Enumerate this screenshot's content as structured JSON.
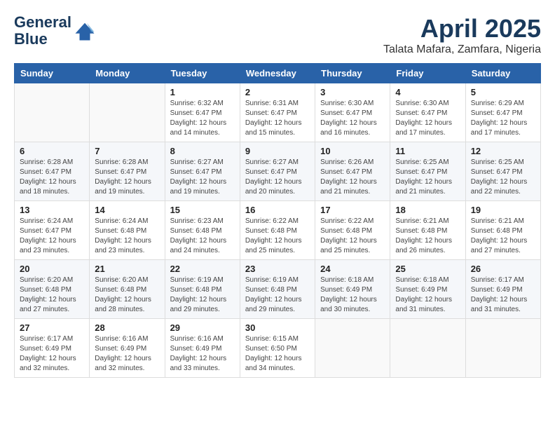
{
  "header": {
    "logo_line1": "General",
    "logo_line2": "Blue",
    "title": "April 2025",
    "subtitle": "Talata Mafara, Zamfara, Nigeria"
  },
  "days_of_week": [
    "Sunday",
    "Monday",
    "Tuesday",
    "Wednesday",
    "Thursday",
    "Friday",
    "Saturday"
  ],
  "weeks": [
    [
      {
        "day": "",
        "sunrise": "",
        "sunset": "",
        "daylight": ""
      },
      {
        "day": "",
        "sunrise": "",
        "sunset": "",
        "daylight": ""
      },
      {
        "day": "1",
        "sunrise": "Sunrise: 6:32 AM",
        "sunset": "Sunset: 6:47 PM",
        "daylight": "Daylight: 12 hours and 14 minutes."
      },
      {
        "day": "2",
        "sunrise": "Sunrise: 6:31 AM",
        "sunset": "Sunset: 6:47 PM",
        "daylight": "Daylight: 12 hours and 15 minutes."
      },
      {
        "day": "3",
        "sunrise": "Sunrise: 6:30 AM",
        "sunset": "Sunset: 6:47 PM",
        "daylight": "Daylight: 12 hours and 16 minutes."
      },
      {
        "day": "4",
        "sunrise": "Sunrise: 6:30 AM",
        "sunset": "Sunset: 6:47 PM",
        "daylight": "Daylight: 12 hours and 17 minutes."
      },
      {
        "day": "5",
        "sunrise": "Sunrise: 6:29 AM",
        "sunset": "Sunset: 6:47 PM",
        "daylight": "Daylight: 12 hours and 17 minutes."
      }
    ],
    [
      {
        "day": "6",
        "sunrise": "Sunrise: 6:28 AM",
        "sunset": "Sunset: 6:47 PM",
        "daylight": "Daylight: 12 hours and 18 minutes."
      },
      {
        "day": "7",
        "sunrise": "Sunrise: 6:28 AM",
        "sunset": "Sunset: 6:47 PM",
        "daylight": "Daylight: 12 hours and 19 minutes."
      },
      {
        "day": "8",
        "sunrise": "Sunrise: 6:27 AM",
        "sunset": "Sunset: 6:47 PM",
        "daylight": "Daylight: 12 hours and 19 minutes."
      },
      {
        "day": "9",
        "sunrise": "Sunrise: 6:27 AM",
        "sunset": "Sunset: 6:47 PM",
        "daylight": "Daylight: 12 hours and 20 minutes."
      },
      {
        "day": "10",
        "sunrise": "Sunrise: 6:26 AM",
        "sunset": "Sunset: 6:47 PM",
        "daylight": "Daylight: 12 hours and 21 minutes."
      },
      {
        "day": "11",
        "sunrise": "Sunrise: 6:25 AM",
        "sunset": "Sunset: 6:47 PM",
        "daylight": "Daylight: 12 hours and 21 minutes."
      },
      {
        "day": "12",
        "sunrise": "Sunrise: 6:25 AM",
        "sunset": "Sunset: 6:47 PM",
        "daylight": "Daylight: 12 hours and 22 minutes."
      }
    ],
    [
      {
        "day": "13",
        "sunrise": "Sunrise: 6:24 AM",
        "sunset": "Sunset: 6:47 PM",
        "daylight": "Daylight: 12 hours and 23 minutes."
      },
      {
        "day": "14",
        "sunrise": "Sunrise: 6:24 AM",
        "sunset": "Sunset: 6:48 PM",
        "daylight": "Daylight: 12 hours and 23 minutes."
      },
      {
        "day": "15",
        "sunrise": "Sunrise: 6:23 AM",
        "sunset": "Sunset: 6:48 PM",
        "daylight": "Daylight: 12 hours and 24 minutes."
      },
      {
        "day": "16",
        "sunrise": "Sunrise: 6:22 AM",
        "sunset": "Sunset: 6:48 PM",
        "daylight": "Daylight: 12 hours and 25 minutes."
      },
      {
        "day": "17",
        "sunrise": "Sunrise: 6:22 AM",
        "sunset": "Sunset: 6:48 PM",
        "daylight": "Daylight: 12 hours and 25 minutes."
      },
      {
        "day": "18",
        "sunrise": "Sunrise: 6:21 AM",
        "sunset": "Sunset: 6:48 PM",
        "daylight": "Daylight: 12 hours and 26 minutes."
      },
      {
        "day": "19",
        "sunrise": "Sunrise: 6:21 AM",
        "sunset": "Sunset: 6:48 PM",
        "daylight": "Daylight: 12 hours and 27 minutes."
      }
    ],
    [
      {
        "day": "20",
        "sunrise": "Sunrise: 6:20 AM",
        "sunset": "Sunset: 6:48 PM",
        "daylight": "Daylight: 12 hours and 27 minutes."
      },
      {
        "day": "21",
        "sunrise": "Sunrise: 6:20 AM",
        "sunset": "Sunset: 6:48 PM",
        "daylight": "Daylight: 12 hours and 28 minutes."
      },
      {
        "day": "22",
        "sunrise": "Sunrise: 6:19 AM",
        "sunset": "Sunset: 6:48 PM",
        "daylight": "Daylight: 12 hours and 29 minutes."
      },
      {
        "day": "23",
        "sunrise": "Sunrise: 6:19 AM",
        "sunset": "Sunset: 6:48 PM",
        "daylight": "Daylight: 12 hours and 29 minutes."
      },
      {
        "day": "24",
        "sunrise": "Sunrise: 6:18 AM",
        "sunset": "Sunset: 6:49 PM",
        "daylight": "Daylight: 12 hours and 30 minutes."
      },
      {
        "day": "25",
        "sunrise": "Sunrise: 6:18 AM",
        "sunset": "Sunset: 6:49 PM",
        "daylight": "Daylight: 12 hours and 31 minutes."
      },
      {
        "day": "26",
        "sunrise": "Sunrise: 6:17 AM",
        "sunset": "Sunset: 6:49 PM",
        "daylight": "Daylight: 12 hours and 31 minutes."
      }
    ],
    [
      {
        "day": "27",
        "sunrise": "Sunrise: 6:17 AM",
        "sunset": "Sunset: 6:49 PM",
        "daylight": "Daylight: 12 hours and 32 minutes."
      },
      {
        "day": "28",
        "sunrise": "Sunrise: 6:16 AM",
        "sunset": "Sunset: 6:49 PM",
        "daylight": "Daylight: 12 hours and 32 minutes."
      },
      {
        "day": "29",
        "sunrise": "Sunrise: 6:16 AM",
        "sunset": "Sunset: 6:49 PM",
        "daylight": "Daylight: 12 hours and 33 minutes."
      },
      {
        "day": "30",
        "sunrise": "Sunrise: 6:15 AM",
        "sunset": "Sunset: 6:50 PM",
        "daylight": "Daylight: 12 hours and 34 minutes."
      },
      {
        "day": "",
        "sunrise": "",
        "sunset": "",
        "daylight": ""
      },
      {
        "day": "",
        "sunrise": "",
        "sunset": "",
        "daylight": ""
      },
      {
        "day": "",
        "sunrise": "",
        "sunset": "",
        "daylight": ""
      }
    ]
  ]
}
